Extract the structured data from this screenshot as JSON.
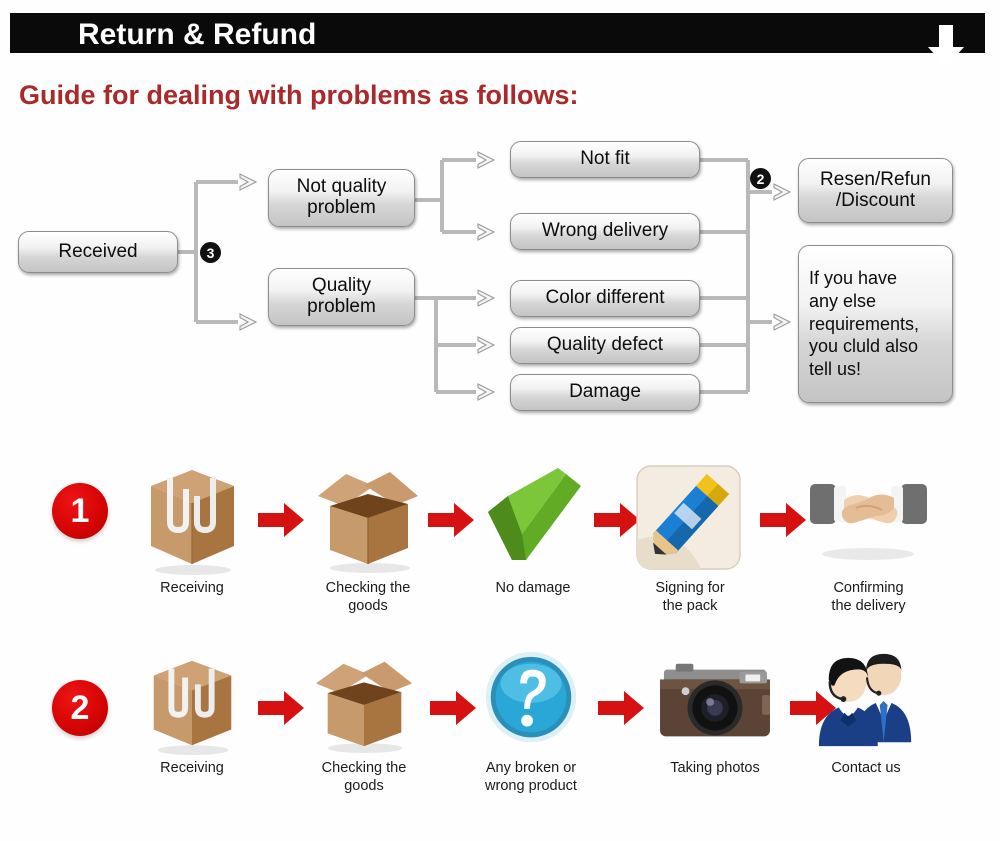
{
  "header": {
    "title": "Return & Refund",
    "arrow_icon": "down-arrow-icon",
    "bar_color": "#0a0a0a",
    "text_color": "#ffffff"
  },
  "guide": {
    "heading": "Guide for dealing with problems as follows:",
    "color": "#a82a2a"
  },
  "flowchart": {
    "start": {
      "label": "Received"
    },
    "branch_badge": "3",
    "merge_badge": "2",
    "categories": [
      {
        "label": "Not quality\nproblem"
      },
      {
        "label": "Quality\nproblem"
      }
    ],
    "reasons": [
      {
        "label": "Not fit"
      },
      {
        "label": "Wrong delivery"
      },
      {
        "label": "Color different"
      },
      {
        "label": "Quality defect"
      },
      {
        "label": "Damage"
      }
    ],
    "outcomes": [
      {
        "label": "Resen/Refun\n/Discount"
      },
      {
        "label": "If you have\nany else\nrequirements,\nyou cluld also\ntell us!"
      }
    ]
  },
  "process_rows": [
    {
      "badge": "1",
      "steps": [
        {
          "icon": "closed-box-icon",
          "label": "Receiving"
        },
        {
          "icon": "open-box-icon",
          "label": "Checking the\ngoods"
        },
        {
          "icon": "green-check-icon",
          "label": "No damage"
        },
        {
          "icon": "pencil-signing-icon",
          "label": "Signing for\nthe pack"
        },
        {
          "icon": "handshake-icon",
          "label": "Confirming\nthe delivery"
        }
      ],
      "arrow_icon": "red-arrow-right-icon"
    },
    {
      "badge": "2",
      "steps": [
        {
          "icon": "closed-box-icon",
          "label": "Receiving"
        },
        {
          "icon": "open-box-icon",
          "label": "Checking the\ngoods"
        },
        {
          "icon": "blue-question-icon",
          "label": "Any broken or\nwrong product"
        },
        {
          "icon": "camera-icon",
          "label": "Taking photos"
        },
        {
          "icon": "support-agents-icon",
          "label": "Contact us"
        }
      ],
      "arrow_icon": "red-arrow-right-icon"
    }
  ],
  "colors": {
    "red_arrow": "#d61111",
    "badge_red": "#d60505",
    "box_border": "#8d8d8d",
    "connector": "#b9b9b9"
  }
}
